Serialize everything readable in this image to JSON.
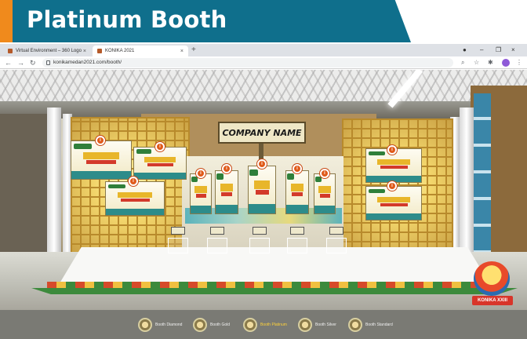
{
  "slide": {
    "title": "Platinum Booth"
  },
  "browser": {
    "tabs": [
      {
        "label": "Virtual Environment – 360 Logo"
      },
      {
        "label": "KONIKA 2021"
      }
    ],
    "new_tab": "+",
    "address": "konikamedan2021.com/booth/",
    "window_controls": {
      "minimize": "–",
      "maximize": "❐",
      "close": "×"
    }
  },
  "booth": {
    "company_name": "COMPANY NAME",
    "badge_glyph": "i"
  },
  "event_logo": {
    "text": "KONIKA XXIII"
  },
  "bottom_nav": {
    "items": [
      {
        "label": "Booth Diamond"
      },
      {
        "label": "Booth Gold"
      },
      {
        "label": "Booth Platinum"
      },
      {
        "label": "Booth Silver"
      },
      {
        "label": "Booth Standard"
      }
    ],
    "active_index": 2
  },
  "colors": {
    "banner_teal": "#0f6f8c",
    "banner_accent": "#f08a1c",
    "active_nav": "#ffd23a",
    "info_badge": "#e05a1a"
  }
}
